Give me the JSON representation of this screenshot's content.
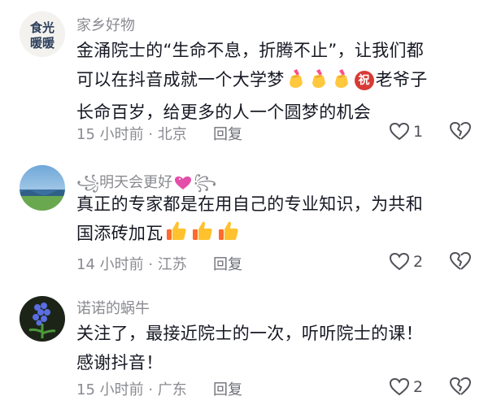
{
  "comments": [
    {
      "avatar_text": "食光暖暖",
      "username": "家乡好物",
      "lines": [
        "金涌院士的“生命不息，折腾不止”，让我们都",
        "可以在抖音成就一个大学梦",
        "老爷子",
        "长命百岁，给更多的人一个圆梦的机会"
      ],
      "badge": "祝",
      "emojis": [
        "finger-heart",
        "finger-heart",
        "finger-heart"
      ],
      "time_location": "15 小时前 · 北京",
      "reply_label": "回复",
      "like_count": "1"
    },
    {
      "username_prefix": "꧁",
      "username": "明天会更好",
      "username_suffix": "꧂",
      "lines": [
        "真正的专家都是在用自己的专业知识，为共和",
        "国添砖加瓦"
      ],
      "emojis": [
        "thumbs-up",
        "thumbs-up",
        "thumbs-up"
      ],
      "time_location": "14 小时前 · 江苏",
      "reply_label": "回复",
      "like_count": "2"
    },
    {
      "username": "诺诺的蜗牛",
      "lines": [
        "关注了，最接近院士的一次，听听院士的课！",
        "感谢抖音！"
      ],
      "time_location": "15 小时前 · 广东",
      "reply_label": "回复",
      "like_count": "2"
    }
  ],
  "colors": {
    "text": "#161823",
    "secondary": "#8a8b91",
    "badge": "#d83a35"
  }
}
